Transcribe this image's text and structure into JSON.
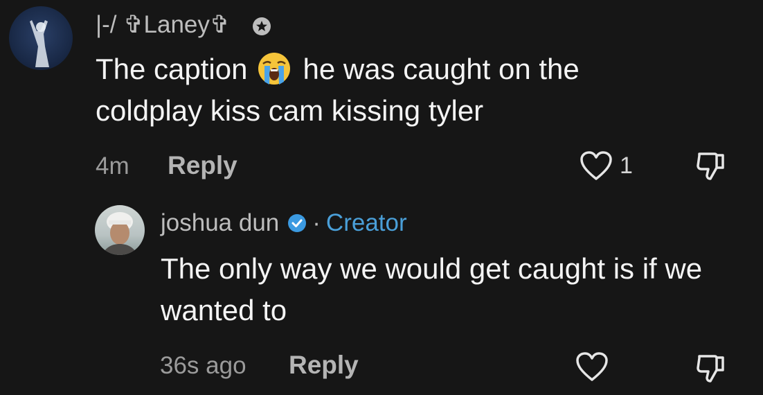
{
  "comment": {
    "username": "|-/ ✞Laney✞",
    "badge_icon": "star-badge-icon",
    "text_before_emoji": "The caption",
    "emoji": "loudly-crying-face",
    "text_after_emoji": "he was caught on the coldplay kiss cam kissing tyler",
    "time": "4m",
    "reply_label": "Reply",
    "like_count": "1"
  },
  "reply": {
    "username": "joshua dun",
    "separator": "·",
    "creator_label": "Creator",
    "text": "The only way we would get caught is if we wanted to",
    "time": "36s ago",
    "reply_label": "Reply"
  },
  "colors": {
    "background": "#161616",
    "creator_blue": "#4a9fd8",
    "verified_blue": "#3b9ae1"
  }
}
